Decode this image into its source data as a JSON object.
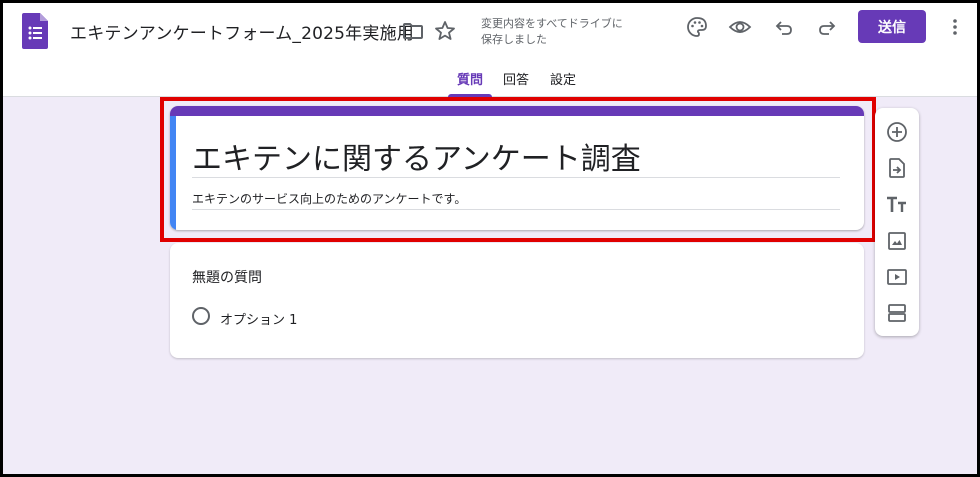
{
  "header": {
    "doc_title": "エキテンアンケートフォーム_2025年実施用",
    "save_status_line1": "変更内容をすべてドライブに",
    "save_status_line2": "保存しました",
    "send_label": "送信"
  },
  "tabs": [
    {
      "label": "質問",
      "active": true
    },
    {
      "label": "回答",
      "active": false
    },
    {
      "label": "設定",
      "active": false
    }
  ],
  "form": {
    "title": "エキテンに関するアンケート調査",
    "description": "エキテンのサービス向上のためのアンケートです。"
  },
  "question": {
    "title": "無題の質問",
    "option1": "オプション 1"
  },
  "colors": {
    "accent": "#673ab7",
    "background": "#f0ebf8",
    "highlight": "#e00000",
    "active_edge": "#4285f4"
  },
  "icons": {
    "header": [
      "forms-logo-icon",
      "folder-icon",
      "star-icon",
      "palette-icon",
      "preview-eye-icon",
      "undo-icon",
      "redo-icon",
      "more-vert-icon"
    ],
    "toolbar": [
      "add-question-icon",
      "import-questions-icon",
      "add-title-icon",
      "add-image-icon",
      "add-video-icon",
      "add-section-icon"
    ]
  }
}
